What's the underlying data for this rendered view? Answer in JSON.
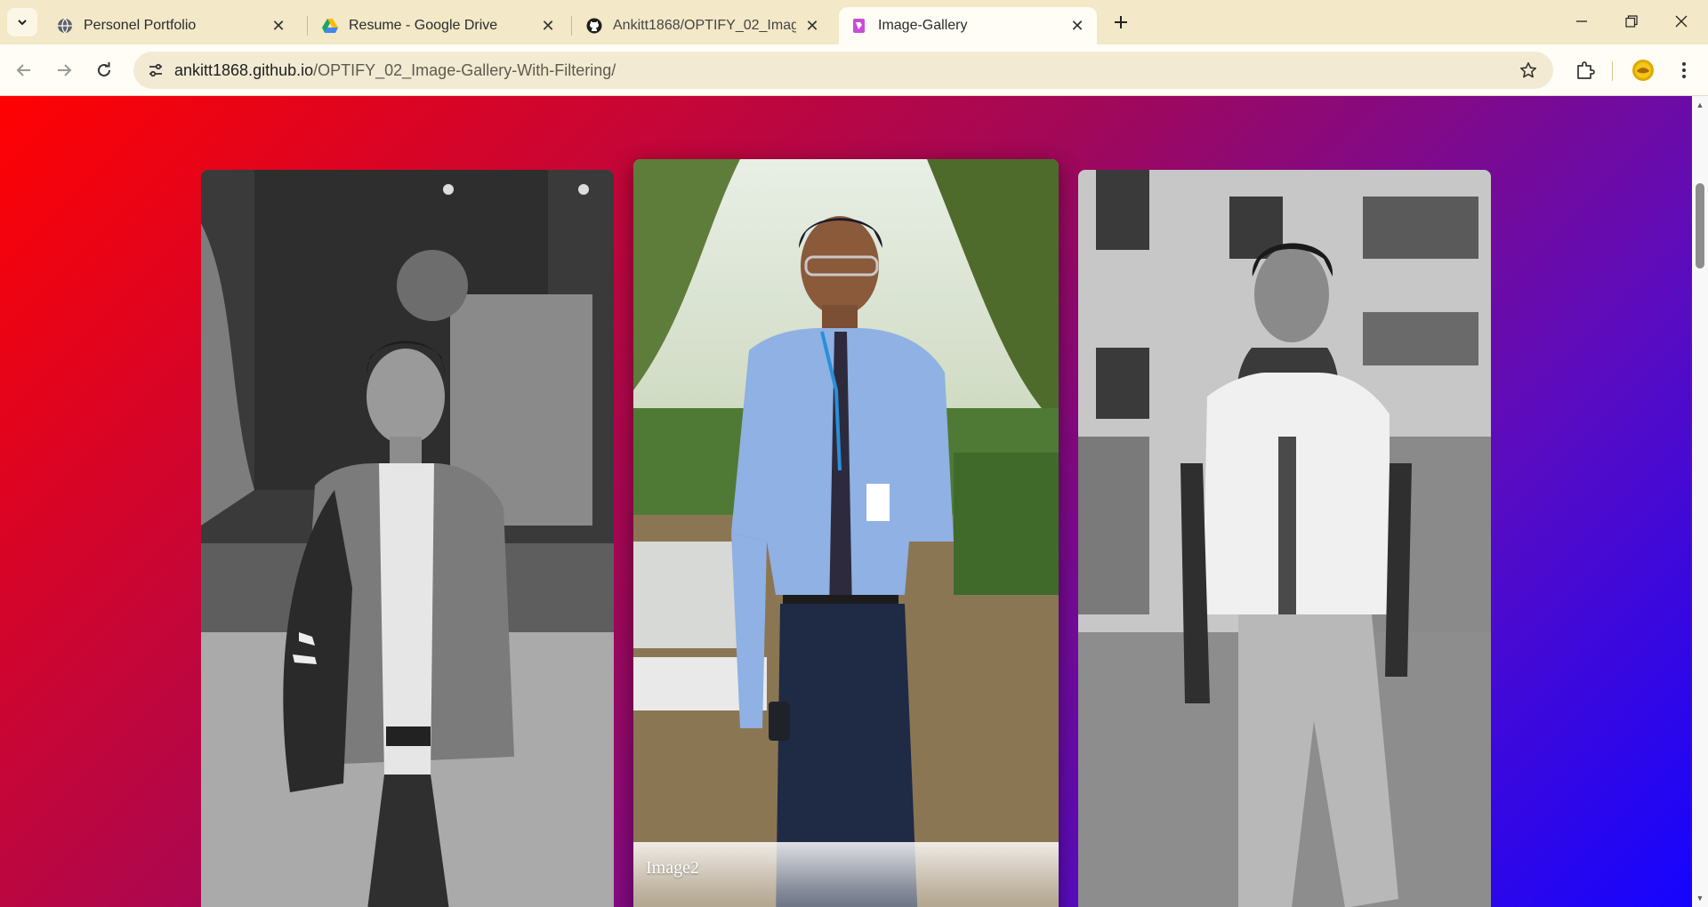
{
  "browser": {
    "tabs": [
      {
        "title": "Personel Portfolio",
        "icon": "globe-icon"
      },
      {
        "title": "Resume - Google Drive",
        "icon": "google-drive-icon"
      },
      {
        "title": "Ankitt1868/OPTIFY_02_Image-G",
        "icon": "github-icon"
      },
      {
        "title": "Image-Gallery",
        "icon": "gallery-icon",
        "active": true
      }
    ],
    "address": {
      "host": "ankitt1868.github.io",
      "path": "/OPTIFY_02_Image-Gallery-With-Filtering/"
    },
    "accent_color": "#f3e8c7"
  },
  "gallery": {
    "background_colors": [
      "#ff0202",
      "#a0085a",
      "#1504ff"
    ],
    "images": [
      {
        "alt": "Grayscale portrait of a young man with a backpack in a jacket",
        "style": "grayscale"
      },
      {
        "alt": "Color portrait of a young man in blue shirt and tie with an ID badge",
        "style": "color",
        "caption": "Image2"
      },
      {
        "alt": "Grayscale portrait of a young man in a scarf in front of a building",
        "style": "grayscale"
      }
    ]
  }
}
